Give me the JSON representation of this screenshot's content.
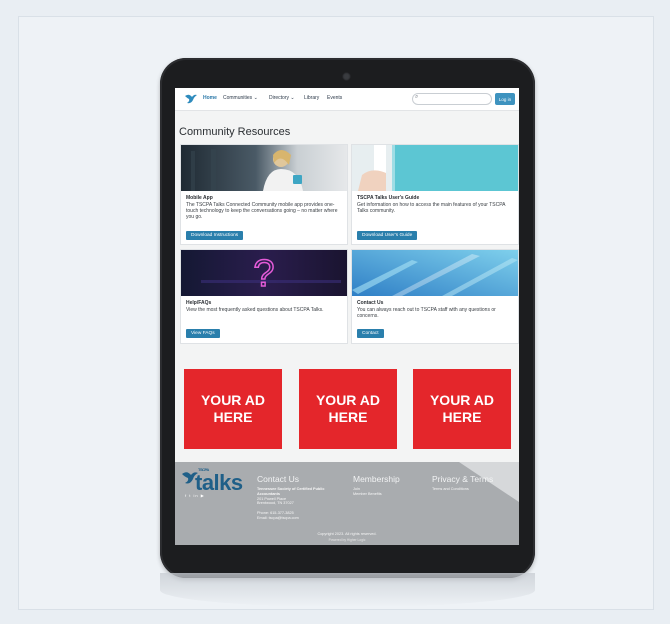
{
  "nav": {
    "items": [
      "Home",
      "Communities",
      "Directory",
      "Library",
      "Events"
    ],
    "search_placeholder": "",
    "login_label": "Log in"
  },
  "page": {
    "title": "Community Resources"
  },
  "cards": [
    {
      "title": "Mobile App",
      "desc": "The TSCPA Talks Connected Community mobile app provides one-touch technology to keep the conversations going – no matter where you go.",
      "button": "Download Instructions"
    },
    {
      "title": "TSCPA Talks User's Guide",
      "desc": "Get information on how to access the main features of your TSCPA Talks community.",
      "button": "Download User's Guide"
    },
    {
      "title": "Help/FAQs",
      "desc": "View the most frequently asked questions about TSCPA Talks.",
      "button": "View FAQs"
    },
    {
      "title": "Contact Us",
      "desc": "You can always reach out to TSCPA staff with any questions or concerns.",
      "button": "Contact"
    }
  ],
  "ads": [
    {
      "line1": "YOUR AD",
      "line2": "HERE"
    },
    {
      "line1": "YOUR AD",
      "line2": "HERE"
    },
    {
      "line1": "YOUR AD",
      "line2": "HERE"
    }
  ],
  "footer": {
    "logo_text": "talks",
    "logo_prefix": "TSCPA",
    "contact": {
      "heading": "Contact Us",
      "org": "Tennessee Society of Certified Public Accountants",
      "address1": "201 Powell Place",
      "address2": "Brentwood, TN 37027",
      "phone": "Phone: 615-377-3825",
      "email": "Email: tscpa@tscpa.com"
    },
    "membership": {
      "heading": "Membership",
      "links": [
        "Join",
        "Member Benefits"
      ]
    },
    "privacy": {
      "heading": "Privacy & Terms",
      "links": [
        "Terms and Conditions"
      ]
    },
    "copyright": "Copyright 2023. All rights reserved.",
    "powered": "Powered by Higher Logic"
  },
  "colors": {
    "accent": "#2a7fac",
    "ad_red": "#e4262b",
    "footer_bg": "#a9acaf"
  },
  "icons": {
    "logo": "tscpa-bird-logo",
    "search": "search-icon",
    "dropdown": "chevron-down-icon"
  }
}
